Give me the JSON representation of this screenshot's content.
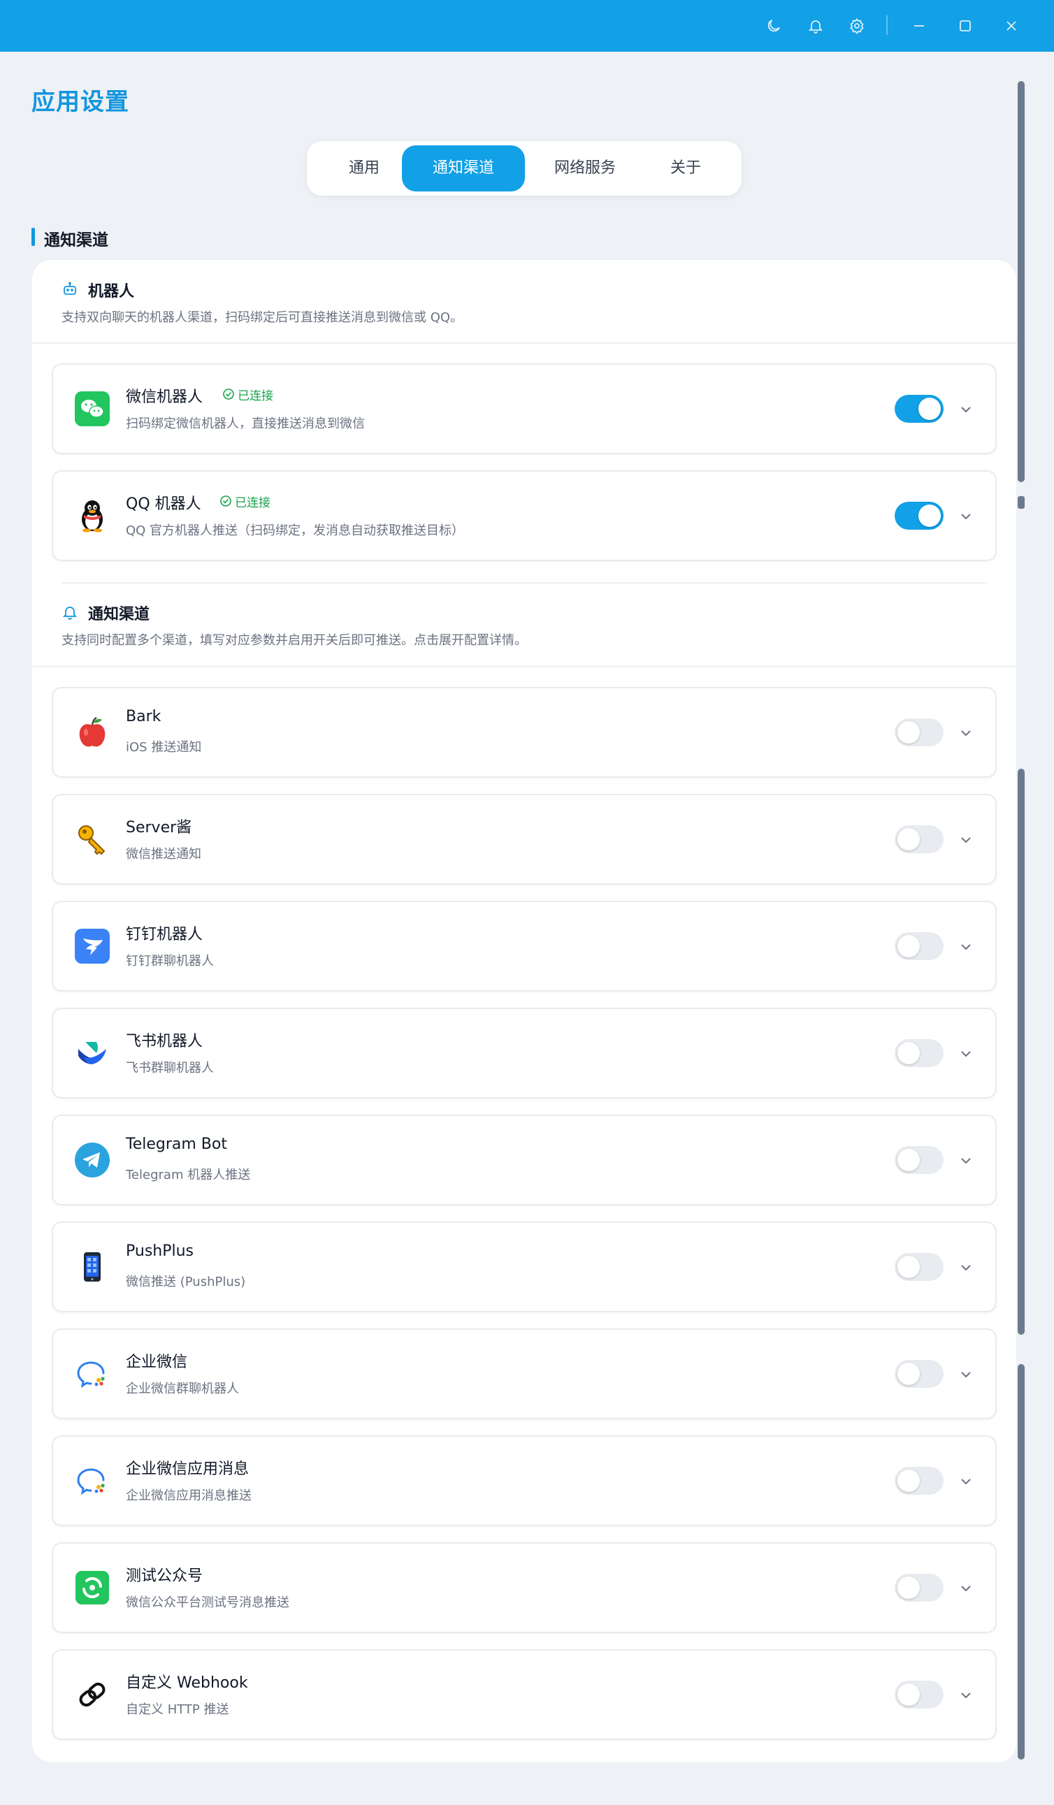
{
  "window": {
    "theme_icon": "moon-icon",
    "bell_icon": "bell-icon",
    "settings_icon": "gear-icon"
  },
  "page": {
    "title": "应用设置"
  },
  "tabs": [
    {
      "label": "通用",
      "active": false
    },
    {
      "label": "通知渠道",
      "active": true
    },
    {
      "label": "网络服务",
      "active": false
    },
    {
      "label": "关于",
      "active": false
    }
  ],
  "section": {
    "title": "通知渠道"
  },
  "robots": {
    "title": "机器人",
    "desc": "支持双向聊天的机器人渠道，扫码绑定后可直接推送消息到微信或 QQ。",
    "items": [
      {
        "name": "微信机器人",
        "badge": "已连接",
        "desc": "扫码绑定微信机器人，直接推送消息到微信",
        "enabled": true,
        "icon": "wechat-icon"
      },
      {
        "name": "QQ 机器人",
        "badge": "已连接",
        "desc": "QQ 官方机器人推送（扫码绑定，发消息自动获取推送目标）",
        "enabled": true,
        "icon": "qq-penguin-icon"
      }
    ]
  },
  "channels": {
    "title": "通知渠道",
    "desc": "支持同时配置多个渠道，填写对应参数并启用开关后即可推送。点击展开配置详情。",
    "items": [
      {
        "name": "Bark",
        "desc": "iOS 推送通知",
        "enabled": false,
        "icon": "apple-fruit-icon"
      },
      {
        "name": "Server酱",
        "desc": "微信推送通知",
        "enabled": false,
        "icon": "key-icon"
      },
      {
        "name": "钉钉机器人",
        "desc": "钉钉群聊机器人",
        "enabled": false,
        "icon": "dingtalk-icon"
      },
      {
        "name": "飞书机器人",
        "desc": "飞书群聊机器人",
        "enabled": false,
        "icon": "feishu-icon"
      },
      {
        "name": "Telegram Bot",
        "desc": "Telegram 机器人推送",
        "enabled": false,
        "icon": "telegram-icon"
      },
      {
        "name": "PushPlus",
        "desc": "微信推送 (PushPlus)",
        "enabled": false,
        "icon": "mobile-phone-icon"
      },
      {
        "name": "企业微信",
        "desc": "企业微信群聊机器人",
        "enabled": false,
        "icon": "wecom-icon"
      },
      {
        "name": "企业微信应用消息",
        "desc": "企业微信应用消息推送",
        "enabled": false,
        "icon": "wecom-icon"
      },
      {
        "name": "测试公众号",
        "desc": "微信公众平台测试号消息推送",
        "enabled": false,
        "icon": "wechat-official-account-icon"
      },
      {
        "name": "自定义 Webhook",
        "desc": "自定义 HTTP 推送",
        "enabled": false,
        "icon": "webhook-link-icon"
      }
    ]
  },
  "colors": {
    "primary": "#12a0e6",
    "success": "#16a34a",
    "background": "#eef1f5"
  }
}
